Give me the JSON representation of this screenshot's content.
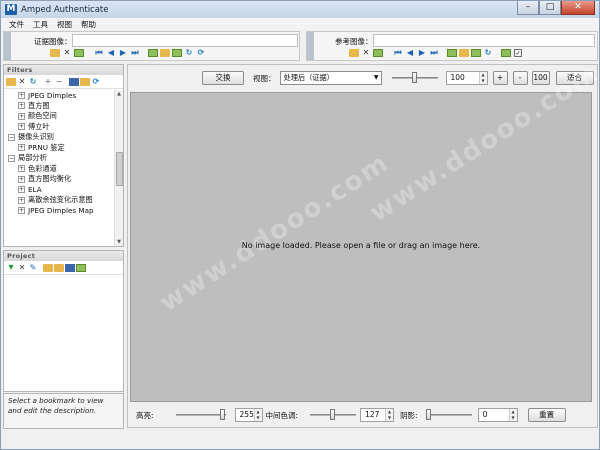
{
  "app": {
    "title": "Amped Authenticate",
    "logo_letter": "M"
  },
  "window_controls": {
    "minimize": "–",
    "maximize": "□",
    "close": "✕"
  },
  "menu": [
    "文件",
    "工具",
    "视图",
    "帮助"
  ],
  "evidence_panel": {
    "label": "证据图像：",
    "value": ""
  },
  "reference_panel": {
    "label": "参考图像：",
    "value": ""
  },
  "filters": {
    "header": "Filters",
    "tree": [
      {
        "label": "JPEG Dimples",
        "level": 1,
        "expander": "+"
      },
      {
        "label": "直方图",
        "level": 1,
        "expander": "+"
      },
      {
        "label": "颜色空间",
        "level": 1,
        "expander": "+"
      },
      {
        "label": "傅立叶",
        "level": 1,
        "expander": "+"
      },
      {
        "label": "摄像头识别",
        "level": 0,
        "expander": "−"
      },
      {
        "label": "PRNU 鉴定",
        "level": 1,
        "expander": "+"
      },
      {
        "label": "局部分析",
        "level": 0,
        "expander": "−"
      },
      {
        "label": "色彩通道",
        "level": 1,
        "expander": "+"
      },
      {
        "label": "直方图均衡化",
        "level": 1,
        "expander": "+"
      },
      {
        "label": "ELA",
        "level": 1,
        "expander": "+"
      },
      {
        "label": "离散余弦变化示意图",
        "level": 1,
        "expander": "+"
      },
      {
        "label": "JPEG Dimples Map",
        "level": 1,
        "expander": "+"
      }
    ]
  },
  "project": {
    "header": "Project",
    "description": "Select a bookmark to view and edit the description."
  },
  "viewbar": {
    "swap_button": "交换",
    "view_label": "视图：",
    "view_select": "处理后（证据）",
    "zoom_value": "100",
    "zoom_in": "+",
    "zoom_out": "-",
    "zoom_100": "100",
    "fit_button": "适合"
  },
  "canvas": {
    "message": "No image loaded. Please open a file or drag an image here."
  },
  "adjust": {
    "highlights_label": "高亮:",
    "highlights_value": "255",
    "midtones_label": "中间色调:",
    "midtones_value": "127",
    "shadows_label": "阴影:",
    "shadows_value": "0",
    "reset_button": "重置"
  },
  "watermark": "www.ddooo.com"
}
